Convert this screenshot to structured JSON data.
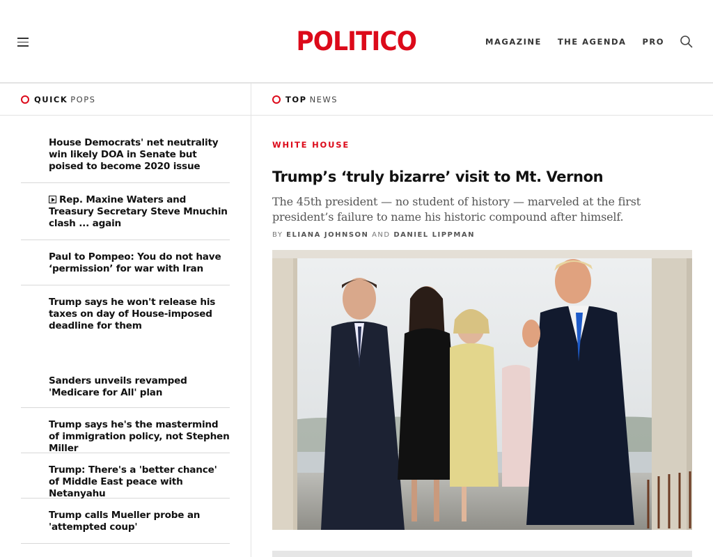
{
  "header": {
    "logo": "POLITICO",
    "nav": [
      "MAGAZINE",
      "THE AGENDA",
      "PRO"
    ],
    "menu_icon": "hamburger-icon",
    "search_icon": "search-icon"
  },
  "quick_pops": {
    "label_strong": "QUICK",
    "label_light": "POPS",
    "items": [
      {
        "title": "House Democrats' net neutrality win likely DOA in Senate but poised to become 2020 issue"
      },
      {
        "title": "Rep. Maxine Waters and Treasury Secretary Steve Mnuchin clash ... again",
        "video": true
      },
      {
        "title": "Paul to Pompeo: You do not have ‘permission’ for war with Iran"
      },
      {
        "title": "Trump says he won't release his taxes on day of House-imposed deadline for them"
      },
      {
        "title": "Sanders unveils revamped 'Medicare for All' plan"
      },
      {
        "title": "Trump says he's the mastermind of immigration policy, not Stephen Miller"
      },
      {
        "title": "Trump: There's a 'better chance' of Middle East peace with Netanyahu"
      },
      {
        "title": "Trump calls Mueller probe an 'attempted coup'"
      }
    ]
  },
  "top_news": {
    "label_strong": "TOP",
    "label_light": "NEWS",
    "kicker": "WHITE HOUSE",
    "headline": "Trump’s ‘truly bizarre’ visit to Mt. Vernon",
    "dek": "The 45th president — no student of history — marveled at the first president’s failure to name his historic compound after himself.",
    "byline_prefix": "BY",
    "author1": "ELIANA JOHNSON",
    "byline_and": "AND",
    "author2": "DANIEL LIPPMAN"
  },
  "colors": {
    "brand_red": "#dc0a1a",
    "divider": "#e3e3e3"
  }
}
